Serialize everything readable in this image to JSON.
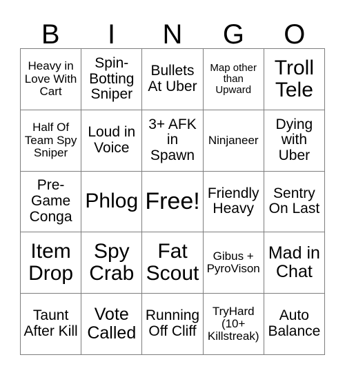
{
  "card": {
    "header_letters": [
      "B",
      "I",
      "N",
      "G",
      "O"
    ],
    "grid_columns": 5,
    "grid_rows": 5,
    "colors": {
      "background": "#ffffff",
      "text": "#000000",
      "grid_line": "#7d7d7d"
    },
    "free_space": {
      "row": 2,
      "column": 2,
      "label": "Free!"
    },
    "rows": [
      [
        {
          "text": "Heavy in Love With Cart",
          "size": "sm"
        },
        {
          "text": "Spin-Botting Sniper",
          "size": "md"
        },
        {
          "text": "Bullets At Uber",
          "size": "md"
        },
        {
          "text": "Map other than Upward",
          "size": "xs"
        },
        {
          "text": "Troll Tele",
          "size": "xl"
        }
      ],
      [
        {
          "text": "Half Of Team Spy Sniper",
          "size": "sm"
        },
        {
          "text": "Loud in Voice",
          "size": "md"
        },
        {
          "text": "3+ AFK in Spawn",
          "size": "md"
        },
        {
          "text": "Ninjaneer",
          "size": "sm"
        },
        {
          "text": "Dying with Uber",
          "size": "md"
        }
      ],
      [
        {
          "text": "Pre-Game Conga",
          "size": "md"
        },
        {
          "text": "Phlog",
          "size": "xl"
        },
        {
          "text": "Free!",
          "size": "xxl"
        },
        {
          "text": "Friendly Heavy",
          "size": "md"
        },
        {
          "text": "Sentry On Last",
          "size": "md"
        }
      ],
      [
        {
          "text": "Item Drop",
          "size": "xl"
        },
        {
          "text": "Spy Crab",
          "size": "xl"
        },
        {
          "text": "Fat Scout",
          "size": "xl"
        },
        {
          "text": "Gibus + PyroVison",
          "size": "sm"
        },
        {
          "text": "Mad in Chat",
          "size": "lg"
        }
      ],
      [
        {
          "text": "Taunt After Kill",
          "size": "md"
        },
        {
          "text": "Vote Called",
          "size": "lg"
        },
        {
          "text": "Running Off Cliff",
          "size": "md"
        },
        {
          "text": "TryHard (10+ Killstreak)",
          "size": "sm"
        },
        {
          "text": "Auto Balance",
          "size": "md"
        }
      ]
    ]
  }
}
